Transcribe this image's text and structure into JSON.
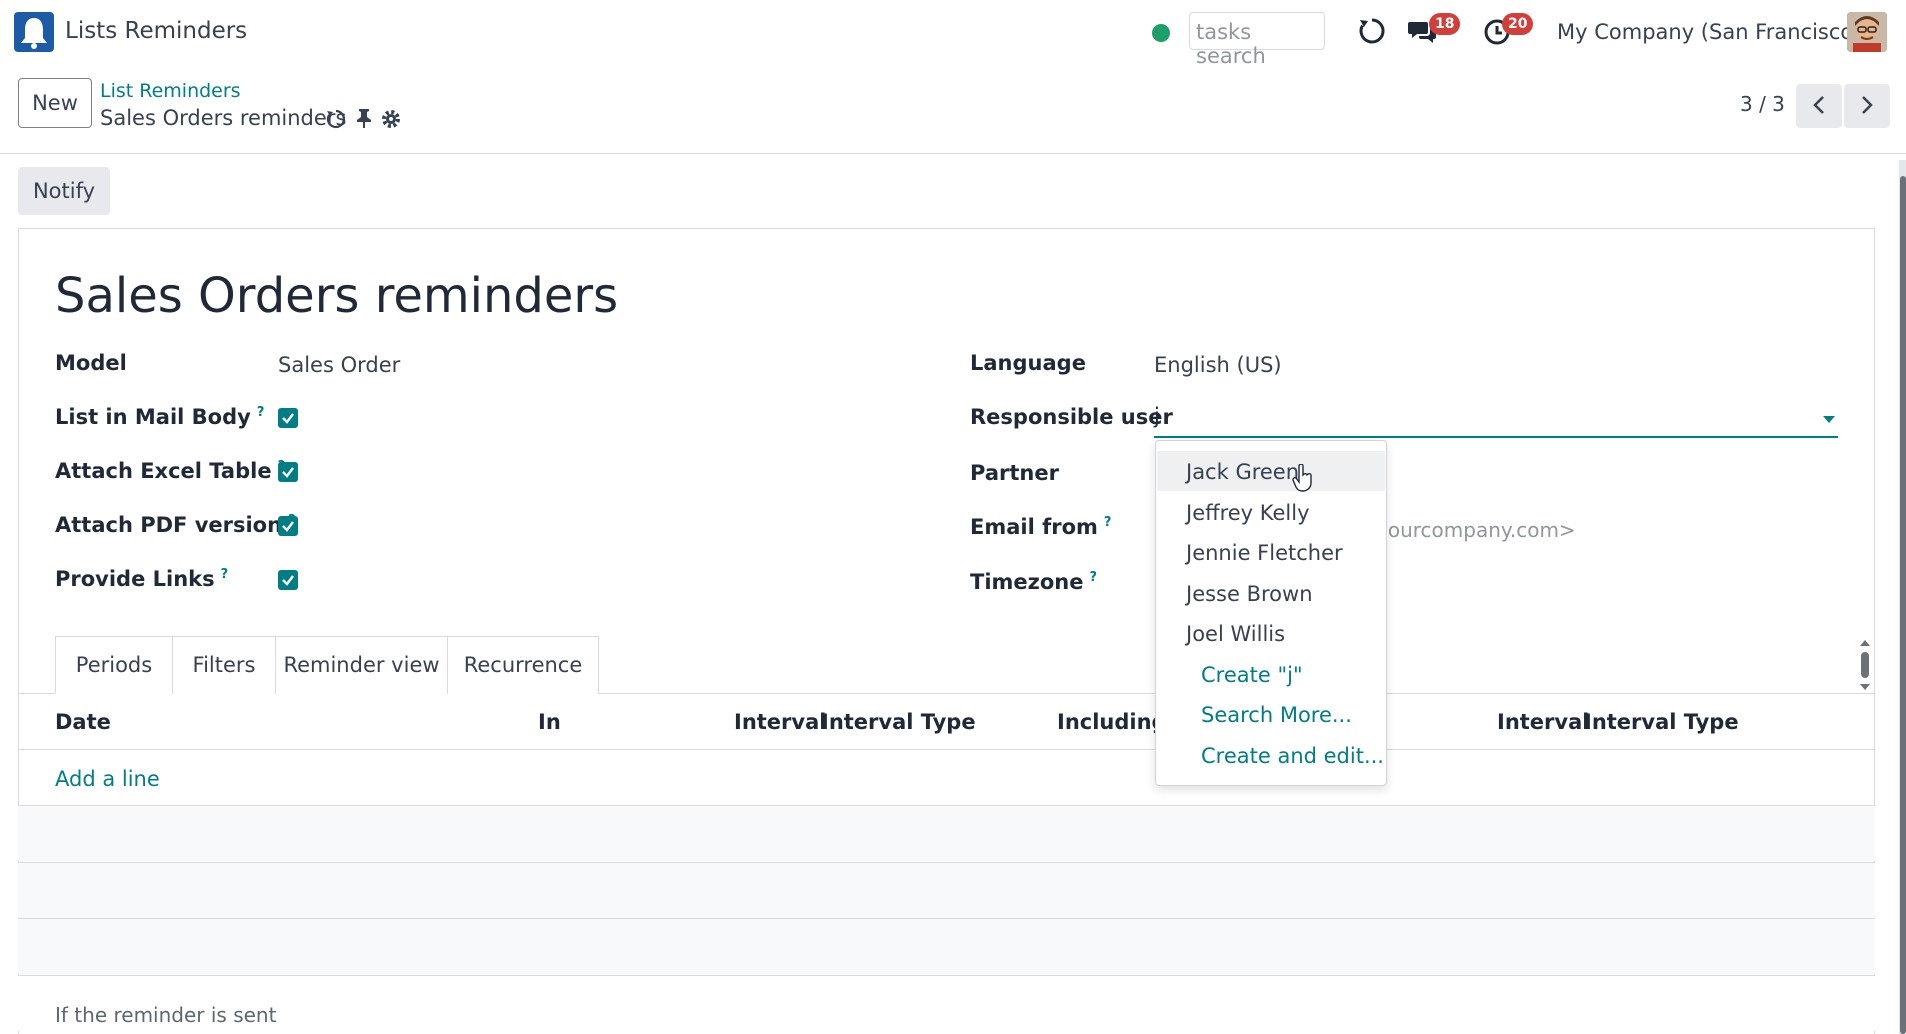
{
  "navbar": {
    "app_name": "Lists Reminders",
    "search_placeholder": "tasks search",
    "chat_count": "18",
    "activity_count": "20",
    "company": "My Company (San Francisco)"
  },
  "control_panel": {
    "new_label": "New",
    "breadcrumb_parent": "List Reminders",
    "breadcrumb_current": "Sales Orders reminders",
    "pager": "3 / 3"
  },
  "actions": {
    "notify_label": "Notify"
  },
  "form": {
    "title": "Sales Orders reminders",
    "left": {
      "model_label": "Model",
      "model_value": "Sales Order",
      "list_in_mail_body_label": "List in Mail Body",
      "attach_excel_label": "Attach Excel Table",
      "attach_pdf_label": "Attach PDF version",
      "provide_links_label": "Provide Links",
      "checkboxes": [
        true,
        true,
        true,
        true
      ]
    },
    "right": {
      "language_label": "Language",
      "language_value": "English (US)",
      "responsible_label": "Responsible user",
      "responsible_value": "j",
      "partner_label": "Partner",
      "email_from_label": "Email from",
      "email_from_partial": "yourcompany.com>",
      "timezone_label": "Timezone"
    },
    "help_mark": "?"
  },
  "tabs": [
    "Periods",
    "Filters",
    "Reminder view",
    "Recurrence"
  ],
  "table": {
    "headers": {
      "date": "Date",
      "in": "In",
      "interval": "Interval",
      "interval_type": "Interval Type",
      "including": "Including",
      "interval_2": "Interval",
      "interval_type_2": "Interval Type"
    },
    "add_line": "Add a line"
  },
  "footer_note": "If the reminder is sent",
  "autocomplete": {
    "options": [
      "Jack Green",
      "Jeffrey Kelly",
      "Jennie Fletcher",
      "Jesse Brown",
      "Joel Willis"
    ],
    "create_label": "Create \"j\"",
    "search_more_label": "Search More...",
    "create_edit_label": "Create and edit..."
  },
  "colors": {
    "accent": "#017e84",
    "badge": "#d23f3a",
    "presence": "#1e9e6a"
  }
}
